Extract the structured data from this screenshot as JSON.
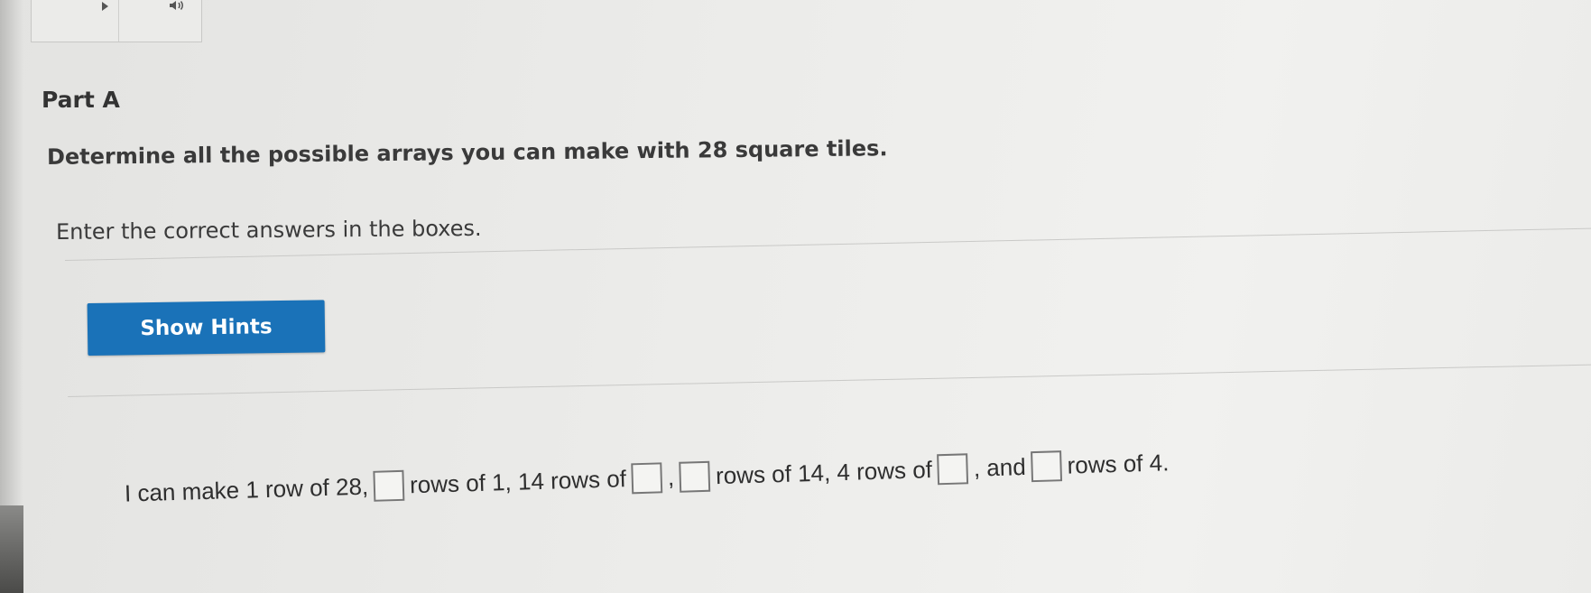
{
  "part": {
    "title": "Part A"
  },
  "question": {
    "prompt": "Determine all the possible arrays you can make with 28 square tiles.",
    "instruction": "Enter the correct answers in the boxes."
  },
  "hints": {
    "button_label": "Show Hints"
  },
  "answer_sentence": {
    "seg1": "I can make 1 row of 28,",
    "seg2": "rows of 1, 14 rows of",
    "seg3": ",",
    "seg4": "rows of 14, 4 rows of",
    "seg5": ", and",
    "seg6": "rows of 4.",
    "box_values": [
      "",
      "",
      "",
      "",
      ""
    ]
  },
  "icons": {
    "audio_play": "play-icon",
    "audio_volume": "speaker-icon"
  },
  "colors": {
    "accent_button": "#1a72b8",
    "background": "#ececea"
  }
}
